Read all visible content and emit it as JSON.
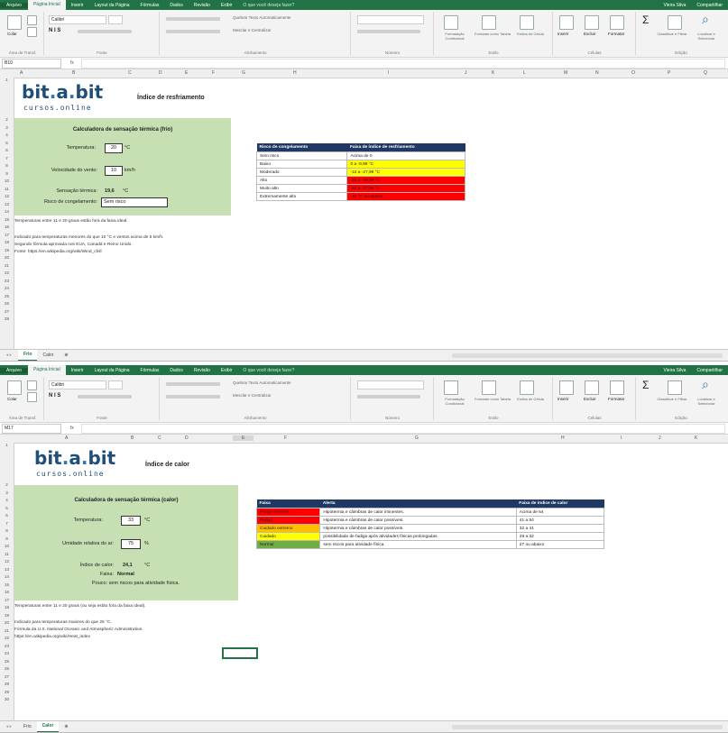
{
  "window1": {
    "tabs": {
      "file": "Arquivo",
      "home": "Página Inicial",
      "insert": "Inserir",
      "layout": "Layout da Página",
      "formulas": "Fórmulas",
      "data": "Dados",
      "review": "Revisão",
      "view": "Exibir",
      "search": "O que você deseja fazer?",
      "user": "Vieira Silva",
      "share": "Compartilhar"
    },
    "groups": [
      "Área de Transf.",
      "Fonte",
      "Alinhamento",
      "Número",
      "Estilo",
      "Células",
      "Edição"
    ],
    "ribbon": {
      "paste": "Colar",
      "font_name": "Calibri",
      "format_cond": "Formatação Condicional",
      "format_table": "Formatar como Tabela",
      "cell_styles": "Estilos de Célula",
      "insert": "Inserir",
      "delete": "Excluir",
      "format": "Formatar",
      "sort": "Classificar e Filtrar",
      "find": "Localizar e Selecionar",
      "wrap": "Quebrar Texto Automaticamente",
      "merge": "Mesclar e Centralizar"
    },
    "namebox": "B10",
    "fx": "fx",
    "columns": [
      "A",
      "B",
      "C",
      "D",
      "E",
      "F",
      "G",
      "H",
      "I",
      "J",
      "K",
      "L",
      "M",
      "N",
      "O",
      "P",
      "Q"
    ],
    "rows": [
      "1",
      "2",
      "3",
      "4",
      "5",
      "6",
      "7",
      "8",
      "9",
      "10",
      "11",
      "12",
      "13",
      "14",
      "15",
      "16",
      "17",
      "18",
      "19",
      "20",
      "21",
      "22",
      "23",
      "24",
      "25",
      "26",
      "27",
      "28",
      "29",
      "30",
      "31",
      "32",
      "33",
      "34",
      "35",
      "36",
      "37",
      "38"
    ],
    "logo": {
      "bit": "bit",
      "dot": ".",
      "a": "a",
      "dot2": ".",
      "bit2": "bit",
      "sub": "cursos.online"
    },
    "title": "Índice de resfriamento",
    "calc": {
      "header": "Calculadora de sensação térmica (frio)",
      "temp_label": "Temperatura:",
      "temp_value": "20",
      "temp_unit": "°C",
      "wind_label": "Velocidade do vento:",
      "wind_value": "10",
      "wind_unit": "km/h",
      "feel_label": "Sensação térmica:",
      "feel_value": "19,6",
      "feel_unit": "°C",
      "risk_label": "Risco de congelamento:",
      "risk_value": "Sem risco"
    },
    "notes": [
      "Temperaturas entre 11 e 20 graus estão fora da faixa ideal.",
      "Indicado para temperaturas menores do que 10 °C e ventos acima de 5 km/h.",
      "Segundo fórmula aprovada nos EUA, Canadá e Reino Unido.",
      "Fonte: https://en.wikipedia.org/wiki/Wind_chill"
    ],
    "table": {
      "headers": [
        "Risco de congelamento",
        "Faixa de índice de resfriamento"
      ],
      "rows": [
        {
          "risk": "Sem risco",
          "range": "Acima de 0",
          "color": "#ffffff"
        },
        {
          "risk": "Baixo",
          "range": "0 a -9,99 °C",
          "color": "#ffff00"
        },
        {
          "risk": "Moderado",
          "range": "-10 a -27,99 °C",
          "color": "#ffff00"
        },
        {
          "risk": "Alto",
          "range": "-28 a -39,99 °C",
          "color": "#ff0000"
        },
        {
          "risk": "Muito alto",
          "range": "-40 a -47,99 °C",
          "color": "#ff0000"
        },
        {
          "risk": "Extremamente alto",
          "range": "-48 °C ou abaixo",
          "color": "#ff0000"
        }
      ]
    },
    "sheet_tabs": [
      "Frio",
      "Calor"
    ],
    "active_sheet": "Frio"
  },
  "window2": {
    "namebox": "M17",
    "title": "Índice de calor",
    "calc": {
      "header": "Calculadora de sensação térmica (calor)",
      "temp_label": "Temperatura:",
      "temp_value": "33",
      "temp_unit": "°C",
      "hum_label": "Umidade relativa do ar:",
      "hum_value": "75",
      "hum_unit": "%",
      "idx_label": "Índice de calor:",
      "idx_value": "24,1",
      "idx_unit": "°C",
      "band_label": "Faixa:",
      "band_value": "Normal",
      "advice": "Pouco: sem riscos para atividade física."
    },
    "notes": [
      "Temperaturas entre 11 e 20 graus (ou seja estão fora da faixa ideal).",
      "Indicado para temperaturas maiores do que 26 °C.",
      "Fórmula da U.S. National Oceanic and Atmospheric Administration.",
      "https://en.wikipedia.org/wiki/Heat_index"
    ],
    "table": {
      "headers": [
        "Faixa",
        "Alerta",
        "Faixa de índice de calor"
      ],
      "rows": [
        {
          "band": "Perigo extremo",
          "alert": "Hipotermia e câimbras de calor iminentes.",
          "range": "Acima de 54",
          "color": "#ff0000"
        },
        {
          "band": "Perigo",
          "alert": "Hipotermia e câimbras de calor possíveis.",
          "range": "41 a 54",
          "color": "#ff0000"
        },
        {
          "band": "Cuidado extremo",
          "alert": "Hipotermia e câimbras de calor possíveis.",
          "range": "32 a 41",
          "color": "#ffc000"
        },
        {
          "band": "Cuidado",
          "alert": "possibilidade de fadiga após atividades físicas prolongadas.",
          "range": "28 a 32",
          "color": "#ffff00"
        },
        {
          "band": "Normal",
          "alert": "sem riscos para atividade física.",
          "range": "27 ou abaixo",
          "color": "#70ad47"
        }
      ]
    },
    "active_sheet": "Calor"
  }
}
